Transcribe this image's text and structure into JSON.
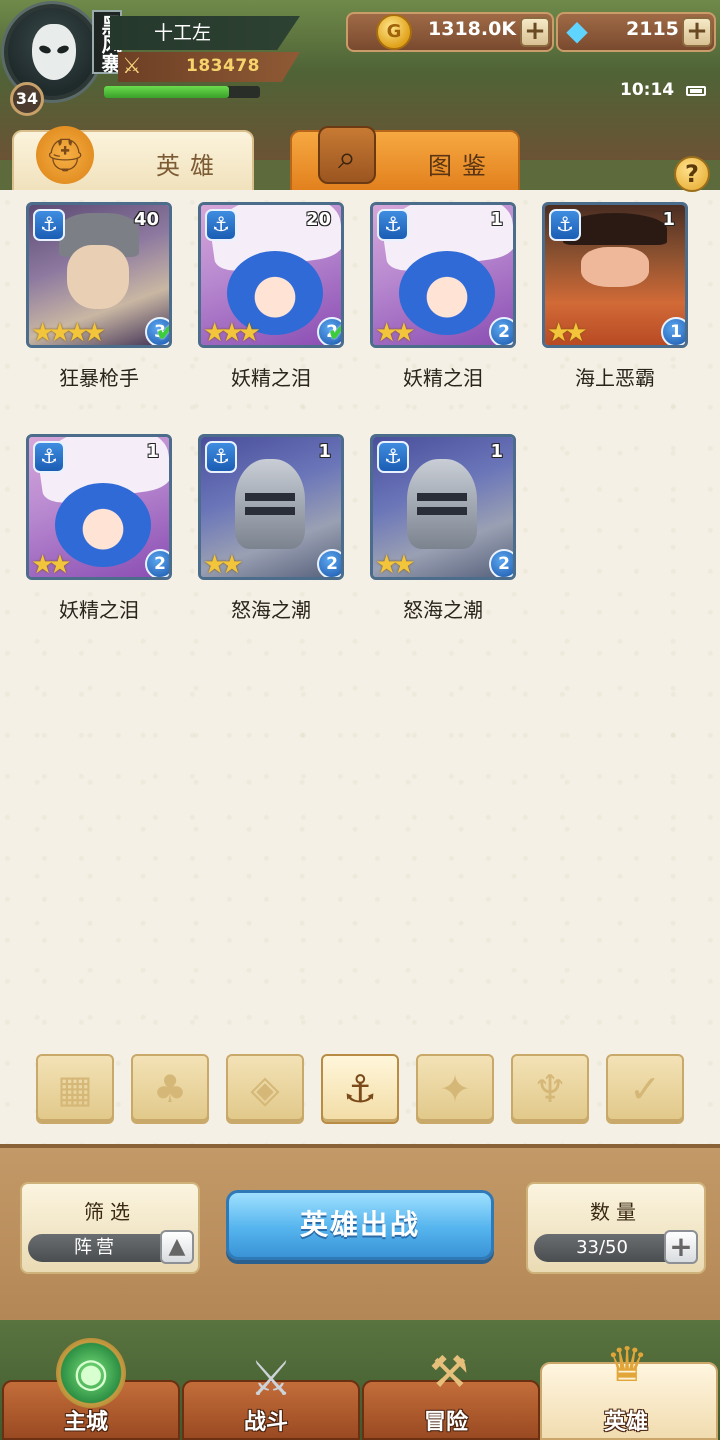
{
  "header": {
    "player_name": "十工左",
    "guild_tag": "黑风寨",
    "level": "34",
    "power": "183478",
    "exp_progress": 0.8,
    "gold": "1318.0K",
    "gems": "2115",
    "time": "10:14"
  },
  "tabs": [
    {
      "label": "英雄",
      "icon": "helmet-icon",
      "active": true
    },
    {
      "label": "图鉴",
      "icon": "magnifier-icon",
      "active": false
    }
  ],
  "help_label": "?",
  "heroes": [
    {
      "name": "狂暴枪手",
      "level": "40",
      "stars": "★★★★",
      "rank": "3",
      "checked": true,
      "faction_icon": "⚓",
      "art": "gunner"
    },
    {
      "name": "妖精之泪",
      "level": "20",
      "stars": "★★★",
      "rank": "2",
      "checked": true,
      "faction_icon": "⚓",
      "art": "fairy"
    },
    {
      "name": "妖精之泪",
      "level": "1",
      "stars": "★★",
      "rank": "2",
      "checked": false,
      "faction_icon": "⚓",
      "art": "fairy"
    },
    {
      "name": "海上恶霸",
      "level": "1",
      "stars": "★★",
      "rank": "1",
      "checked": false,
      "faction_icon": "⚓",
      "art": "pirate"
    },
    {
      "name": "妖精之泪",
      "level": "1",
      "stars": "★★",
      "rank": "2",
      "checked": false,
      "faction_icon": "⚓",
      "art": "fairy"
    },
    {
      "name": "怒海之潮",
      "level": "1",
      "stars": "★★",
      "rank": "2",
      "checked": false,
      "faction_icon": "⚓",
      "art": "knight"
    },
    {
      "name": "怒海之潮",
      "level": "1",
      "stars": "★★",
      "rank": "2",
      "checked": false,
      "faction_icon": "⚓",
      "art": "knight"
    }
  ],
  "check_mark": "✔",
  "faction_filters": [
    {
      "name": "all",
      "glyph": "▦",
      "active": false
    },
    {
      "name": "leaf",
      "glyph": "♣",
      "active": false
    },
    {
      "name": "diamond",
      "glyph": "◈",
      "active": false
    },
    {
      "name": "anchor",
      "glyph": "⚓",
      "active": true
    },
    {
      "name": "beast",
      "glyph": "✦",
      "active": false
    },
    {
      "name": "horns",
      "glyph": "♆",
      "active": false
    },
    {
      "name": "wings",
      "glyph": "✓",
      "active": false
    }
  ],
  "filter_box": {
    "title": "筛选",
    "value": "阵营",
    "button": "▲"
  },
  "deploy_button": "英雄出战",
  "count_box": {
    "title": "数量",
    "value": "33/50",
    "button": "+"
  },
  "bottom_nav": [
    {
      "label": "主城",
      "icon": "◉",
      "active": false
    },
    {
      "label": "战斗",
      "icon": "⚔",
      "active": false
    },
    {
      "label": "冒险",
      "icon": "⚒",
      "active": false
    },
    {
      "label": "英雄",
      "icon": "♛",
      "active": true
    }
  ],
  "colors": {
    "panel_bg": "#f4f0e5",
    "deploy_button": "#55b4ee",
    "codex_tab": "#e2811e",
    "exp_bar": "#3aa12a"
  }
}
